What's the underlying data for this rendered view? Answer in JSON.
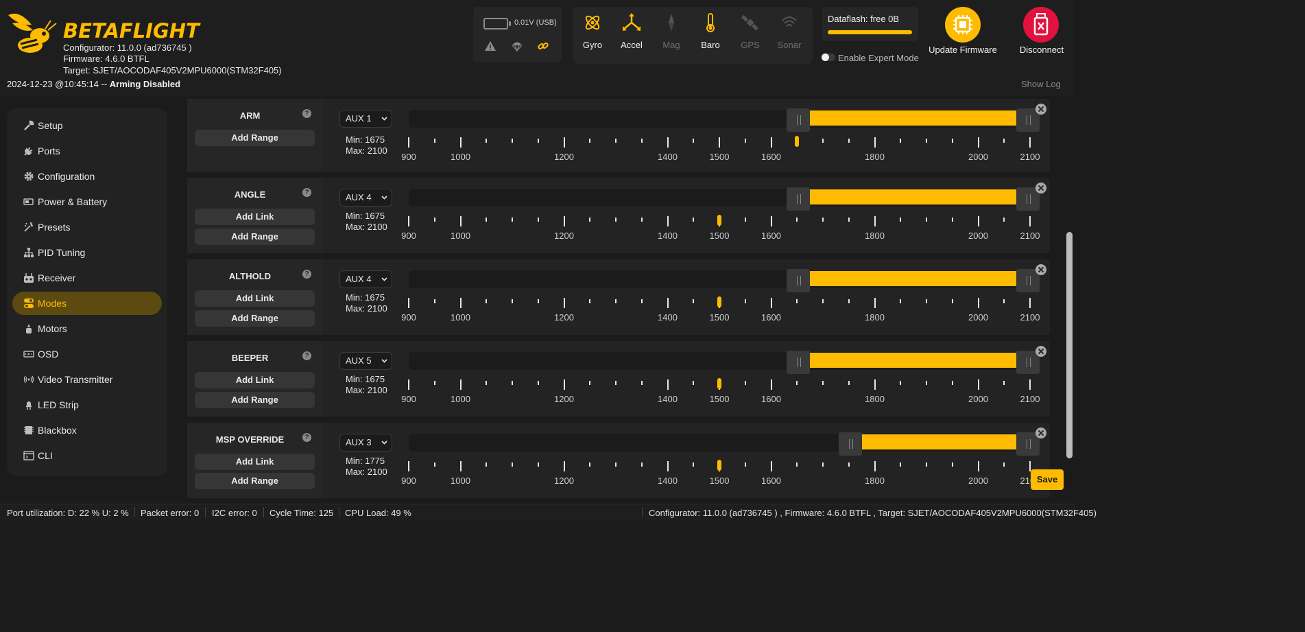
{
  "header": {
    "brand": "BETAFLIGHT",
    "configurator": "Configurator: 11.0.0 (ad736745 )",
    "firmware": "Firmware: 4.6.0 BTFL",
    "target": "Target: SJET/AOCODAF405V2MPU6000(STM32F405)",
    "status_time": "2024-12-23 @10:45:14 -- ",
    "status_state": "Arming Disabled",
    "battery_voltage": "0.01V (USB)",
    "sensors": [
      {
        "label": "Gyro",
        "active": true,
        "icon": "gyro-icon"
      },
      {
        "label": "Accel",
        "active": true,
        "icon": "accel-icon"
      },
      {
        "label": "Mag",
        "active": false,
        "icon": "mag-icon"
      },
      {
        "label": "Baro",
        "active": true,
        "icon": "baro-icon"
      },
      {
        "label": "GPS",
        "active": false,
        "icon": "gps-icon"
      },
      {
        "label": "Sonar",
        "active": false,
        "icon": "sonar-icon"
      }
    ],
    "dataflash": "Dataflash: free 0B",
    "expert_mode": "Enable Expert Mode",
    "update_firmware": "Update Firmware",
    "disconnect": "Disconnect",
    "show_log": "Show Log"
  },
  "sidebar": {
    "items": [
      {
        "label": "Setup",
        "icon": "wrench-icon"
      },
      {
        "label": "Ports",
        "icon": "plug-icon"
      },
      {
        "label": "Configuration",
        "icon": "gear-icon"
      },
      {
        "label": "Power & Battery",
        "icon": "battery-icon"
      },
      {
        "label": "Presets",
        "icon": "magic-wand-icon"
      },
      {
        "label": "PID Tuning",
        "icon": "sitemap-icon"
      },
      {
        "label": "Receiver",
        "icon": "remote-control-icon"
      },
      {
        "label": "Modes",
        "icon": "toggle-icon",
        "active": true
      },
      {
        "label": "Motors",
        "icon": "motor-icon"
      },
      {
        "label": "OSD",
        "icon": "osd-icon"
      },
      {
        "label": "Video Transmitter",
        "icon": "antenna-icon"
      },
      {
        "label": "LED Strip",
        "icon": "led-icon"
      },
      {
        "label": "Blackbox",
        "icon": "blackbox-icon"
      },
      {
        "label": "CLI",
        "icon": "terminal-icon"
      }
    ]
  },
  "modes": {
    "add_link": "Add Link",
    "add_range": "Add Range",
    "help": "?",
    "ticks": [
      900,
      1000,
      1200,
      1400,
      1500,
      1600,
      1800,
      2000,
      2100
    ],
    "list": [
      {
        "name": "ARM",
        "aux": "AUX 1",
        "min": "Min: 1675",
        "max": "Max: 2100",
        "range_min": 1675,
        "range_max": 2100,
        "channel_value": 1650,
        "has_link": false
      },
      {
        "name": "ANGLE",
        "aux": "AUX 4",
        "min": "Min: 1675",
        "max": "Max: 2100",
        "range_min": 1675,
        "range_max": 2100,
        "channel_value": 1500,
        "has_link": true
      },
      {
        "name": "ALTHOLD",
        "aux": "AUX 4",
        "min": "Min: 1675",
        "max": "Max: 2100",
        "range_min": 1675,
        "range_max": 2100,
        "channel_value": 1500,
        "has_link": true
      },
      {
        "name": "BEEPER",
        "aux": "AUX 5",
        "min": "Min: 1675",
        "max": "Max: 2100",
        "range_min": 1675,
        "range_max": 2100,
        "channel_value": 1500,
        "has_link": true
      },
      {
        "name": "MSP OVERRIDE",
        "aux": "AUX 3",
        "min": "Min: 1775",
        "max": "Max: 2100",
        "range_min": 1775,
        "range_max": 2100,
        "channel_value": 1500,
        "has_link": true
      }
    ]
  },
  "save_label": "Save",
  "footer": {
    "port_util": "Port utilization: D: 22 % U: 2 %",
    "packet_error": "Packet error: 0",
    "i2c_error": "I2C error: 0",
    "cycle_time": "Cycle Time: 125",
    "cpu_load": "CPU Load: 49 %",
    "version_info": "Configurator: 11.0.0 (ad736745 ) , Firmware: 4.6.0 BTFL , Target: SJET/AOCODAF405V2MPU6000(STM32F405)"
  },
  "colors": {
    "accent": "#ffbb00",
    "disconnect": "#e2123f",
    "background": "#1b1b1b"
  }
}
